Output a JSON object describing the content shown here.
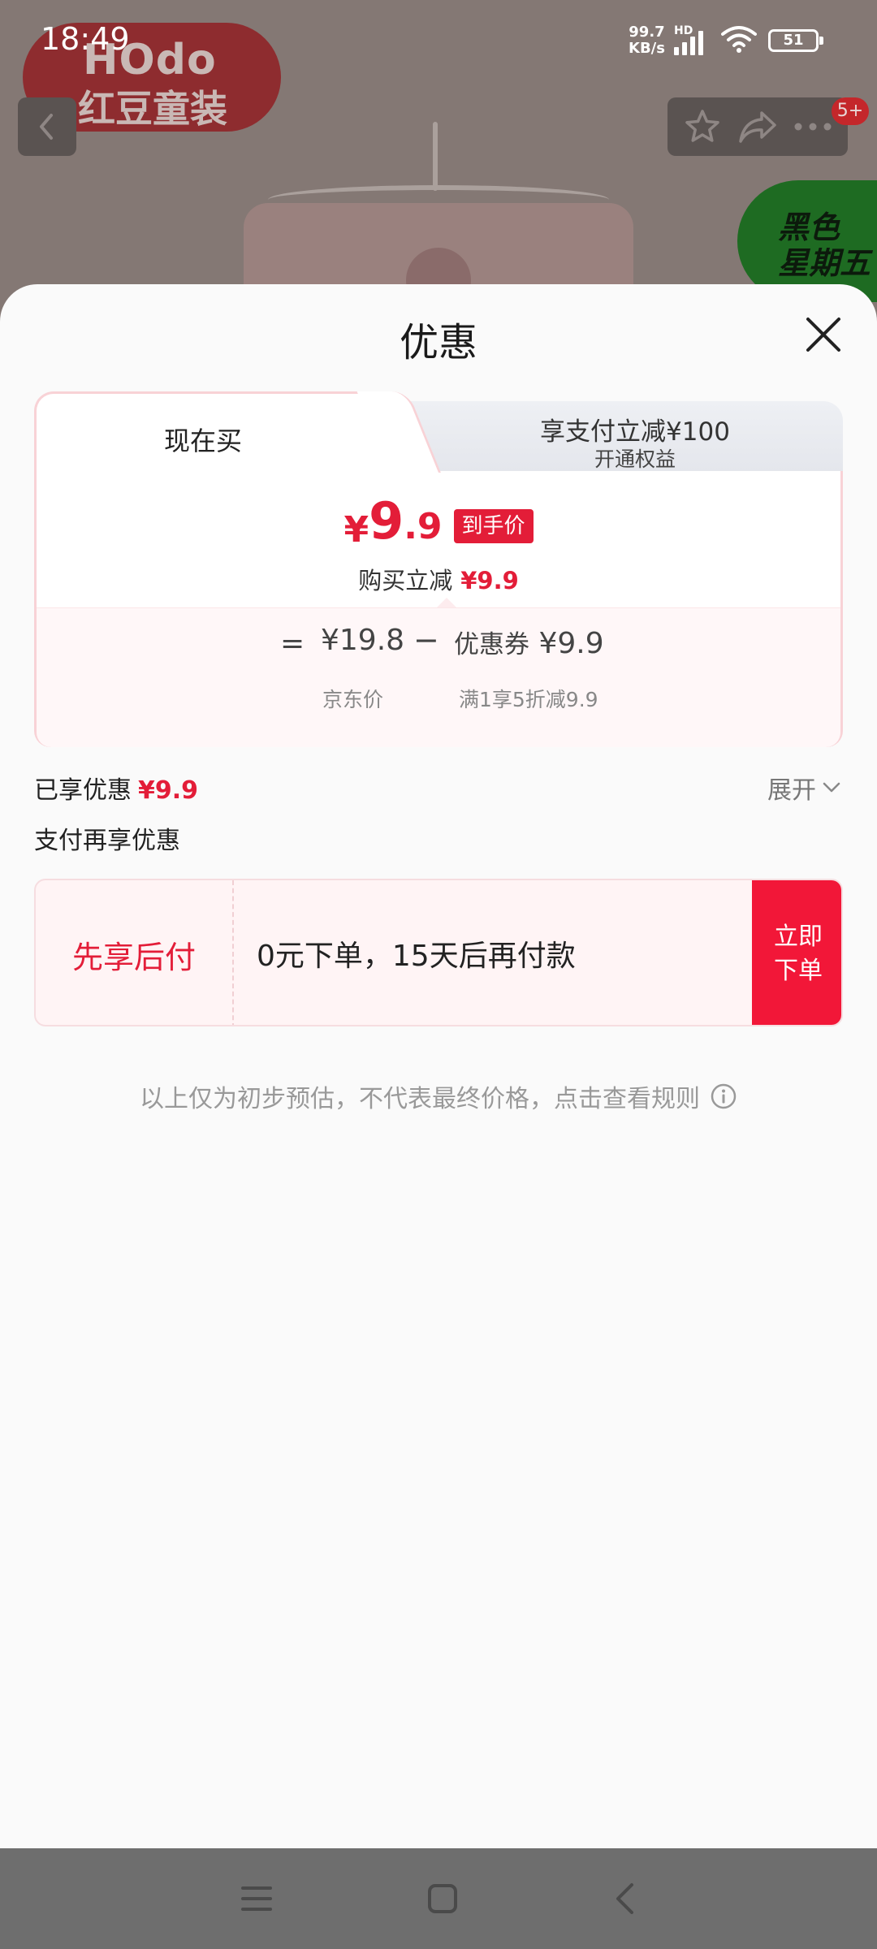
{
  "status_bar": {
    "time": "18:49",
    "net_speed_value": "99.7",
    "net_speed_unit": "KB/s",
    "hd_label": "HD",
    "battery": "51"
  },
  "background": {
    "brand_logo_en": "HOdo",
    "brand_logo_cn": "红豆童装",
    "promo_badge_line1": "黑色",
    "promo_badge_line2": "星期五",
    "message_badge": "5+"
  },
  "sheet": {
    "title": "优惠",
    "tabs": {
      "buy_now": "现在买",
      "pay_discount_title": "享支付立减¥100",
      "pay_discount_sub": "开通权益"
    },
    "final_price": {
      "currency": "¥",
      "integer": "9",
      "decimal": ".9",
      "badge": "到手价"
    },
    "instant_cut": {
      "label": "购买立减",
      "value": "¥9.9"
    },
    "breakdown": {
      "equals": "=",
      "jd_price": "¥19.8",
      "minus": "−",
      "coupon_label": "优惠券",
      "coupon_value": "¥9.9",
      "jd_price_label": "京东价",
      "coupon_rule": "满1享5折减9.9"
    },
    "enjoyed": {
      "label": "已享优惠",
      "value": "¥9.9",
      "expand": "展开"
    },
    "pay_more_title": "支付再享优惠",
    "bnpl": {
      "title": "先享后付",
      "desc": "0元下单，15天后再付款",
      "button_line1": "立即",
      "button_line2": "下单"
    },
    "disclaimer": "以上仅为初步预估，不代表最终价格，点击查看规则"
  },
  "colors": {
    "accent_red": "#e31d38",
    "button_red": "#f21738"
  },
  "icons": [
    "back-icon",
    "star-icon",
    "share-icon",
    "more-icon",
    "close-icon",
    "chevron-down-icon",
    "info-icon",
    "menu-icon",
    "home-icon",
    "nav-back-icon"
  ]
}
